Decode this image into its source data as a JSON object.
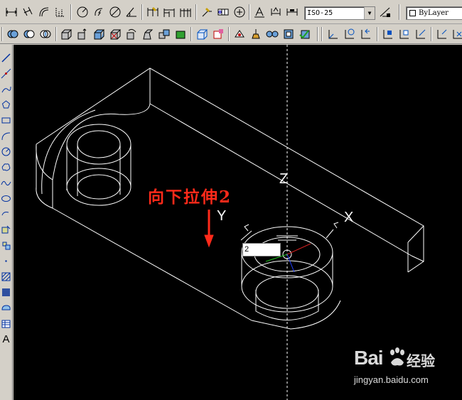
{
  "toolbar_top": {
    "dimension_style": "ISO-25",
    "layer_value": "ByLayer",
    "icons": [
      "linear-dimension-icon",
      "aligned-dimension-icon",
      "arc-length-icon",
      "ordinate-dimension-icon",
      "radius-dimension-icon",
      "jogged-radius-icon",
      "diameter-dimension-icon",
      "angular-dimension-icon",
      "quick-dimension-icon",
      "baseline-dimension-icon",
      "continue-dimension-icon",
      "quick-leader-icon",
      "tolerance-icon",
      "center-mark-icon",
      "dimension-edit-icon",
      "dimension-text-edit-icon",
      "dimension-update-icon",
      "dimension-style-icon"
    ]
  },
  "toolbar_modeling": {
    "icons": [
      "union-icon",
      "subtract-icon",
      "intersect-icon",
      "extrude-faces-icon",
      "move-faces-icon",
      "offset-faces-icon",
      "delete-faces-icon",
      "rotate-faces-icon",
      "taper-faces-icon",
      "copy-faces-icon",
      "color-faces-icon",
      "copy-edges-icon",
      "color-edges-icon",
      "imprint-icon",
      "clean-icon",
      "separate-icon",
      "shell-icon",
      "check-icon",
      "ucs-icon",
      "world-ucs-icon",
      "ucs-previous-icon",
      "face-ucs-icon",
      "object-ucs-icon",
      "view-ucs-icon",
      "origin-ucs-icon"
    ]
  },
  "toolbar_draw": {
    "icons": [
      "line-icon",
      "construction-line-icon",
      "polyline-icon",
      "polygon-icon",
      "rectangle-icon",
      "arc-icon",
      "circle-icon",
      "revision-cloud-icon",
      "spline-icon",
      "ellipse-icon",
      "ellipse-arc-icon",
      "insert-block-icon",
      "make-block-icon",
      "point-icon",
      "hatch-icon",
      "gradient-icon",
      "region-icon",
      "table-icon"
    ],
    "text_label": "A"
  },
  "viewport": {
    "annotation": "向下拉伸2",
    "axis_x": "X",
    "axis_y": "Y",
    "axis_z": "Z",
    "dynamic_input_value": "2"
  },
  "watermark": {
    "logo": "Bai",
    "site": "经验",
    "url": "jingyan.baidu.com"
  },
  "colors": {
    "ui_background": "#d4d0c8",
    "canvas": "#000000",
    "wireframe": "#ffffff",
    "annotation": "#ff2a1a"
  }
}
